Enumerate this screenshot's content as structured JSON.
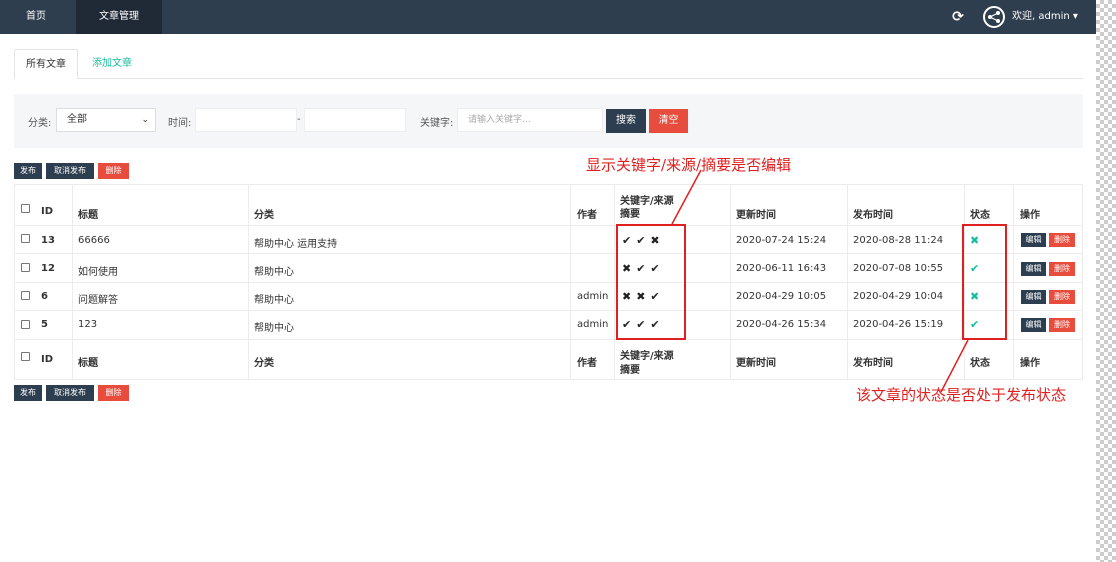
{
  "navbar": {
    "home": "首页",
    "articles": "文章管理",
    "refresh_icon": "refresh-icon",
    "welcome": "欢迎, admin ▾"
  },
  "tabs": {
    "all": "所有文章",
    "add": "添加文章"
  },
  "filter": {
    "category_label": "分类:",
    "category_value": "全部",
    "time_label": "时间:",
    "dash": "-",
    "keyword_label": "关键字:",
    "keyword_placeholder": "请输入关键字...",
    "search": "搜索",
    "clear": "清空"
  },
  "actions": {
    "publish": "发布",
    "unpublish": "取消发布",
    "delete": "删除"
  },
  "table": {
    "headers": {
      "id": "ID",
      "title": "标题",
      "category": "分类",
      "author": "作者",
      "kw_line1": "关键字/来源",
      "kw_line2": "摘要",
      "updated": "更新时间",
      "published": "发布时间",
      "status": "状态",
      "ops": "操作"
    },
    "rows": [
      {
        "id": "13",
        "title": "66666",
        "category": "帮助中心 运用支持",
        "author": "",
        "flags": "✔✔✖",
        "updated": "2020-07-24 15:24",
        "published": "2020-08-28 11:24",
        "status": "✖"
      },
      {
        "id": "12",
        "title": "如何使用",
        "category": "帮助中心",
        "author": "",
        "flags": "✖✔✔",
        "updated": "2020-06-11 16:43",
        "published": "2020-07-08 10:55",
        "status": "✔"
      },
      {
        "id": "6",
        "title": "问题解答",
        "category": "帮助中心",
        "author": "admin",
        "flags": "✖✖✔",
        "updated": "2020-04-29 10:05",
        "published": "2020-04-29 10:04",
        "status": "✖"
      },
      {
        "id": "5",
        "title": "123",
        "category": "帮助中心",
        "author": "admin",
        "flags": "✔✔✔",
        "updated": "2020-04-26 15:34",
        "published": "2020-04-26 15:19",
        "status": "✔"
      }
    ],
    "edit": "编辑",
    "delete": "删除"
  },
  "annotations": {
    "top": "显示关键字/来源/摘要是否编辑",
    "bottom": "该文章的状态是否处于发布状态"
  },
  "colors": {
    "navbar": "#2f3e4e",
    "primary": "#2c3e50",
    "danger": "#e74c3c",
    "success": "#18bc9c",
    "annotation": "#e02020"
  }
}
